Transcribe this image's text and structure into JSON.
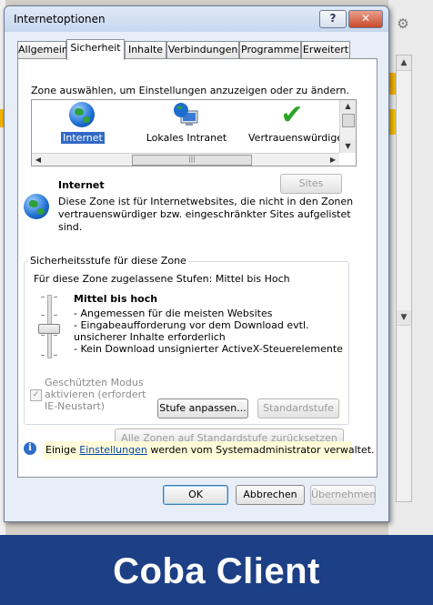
{
  "dialog": {
    "title": "Internetoptionen",
    "help_label": "?",
    "close_label": "✕"
  },
  "tabs": [
    "Allgemein",
    "Sicherheit",
    "Inhalte",
    "Verbindungen",
    "Programme",
    "Erweitert"
  ],
  "active_tab": "Sicherheit",
  "zones": {
    "instruction": "Zone auswählen, um Einstellungen anzuzeigen oder zu ändern.",
    "items": [
      {
        "label": "Internet",
        "icon": "globe-icon",
        "selected": true
      },
      {
        "label": "Lokales Intranet",
        "icon": "intranet-icon",
        "selected": false
      },
      {
        "label": "Vertrauenswürdige",
        "icon": "checkmark-icon",
        "selected": false
      }
    ]
  },
  "zone_detail": {
    "name": "Internet",
    "sites_label": "Sites",
    "description": "Diese Zone ist für Internetwebsites, die nicht in den Zonen vertrauenswürdiger bzw. eingeschränkter Sites aufgelistet sind."
  },
  "security_level": {
    "group_title": "Sicherheitsstufe für diese Zone",
    "allowed": "Für diese Zone zugelassene Stufen: Mittel bis Hoch",
    "level_title": "Mittel bis hoch",
    "items": [
      "- Angemessen für die meisten Websites",
      "- Eingabeaufforderung vor dem Download evtl. unsicherer Inhalte erforderlich",
      "- Kein Download unsignierter ActiveX-Steuerelemente"
    ],
    "protected_mode": "Geschützten Modus aktivieren (erfordert IE-Neustart)",
    "protected_mode_checked": true,
    "custom_button": "Stufe anpassen...",
    "default_button": "Standardstufe"
  },
  "reset_all_button": "Alle Zonen auf Standardstufe zurücksetzen",
  "info": {
    "prefix": "Einige ",
    "link": "Einstellungen",
    "suffix": " werden vom Systemadministrator verwaltet."
  },
  "buttons": {
    "ok": "OK",
    "cancel": "Abbrechen",
    "apply": "Übernehmen"
  },
  "footer_title": "Coba Client",
  "colors": {
    "footer_bg": "#1c3f86",
    "selection": "#3169c6",
    "close_red": "#c9492a",
    "info_bg": "#fffbd8"
  }
}
